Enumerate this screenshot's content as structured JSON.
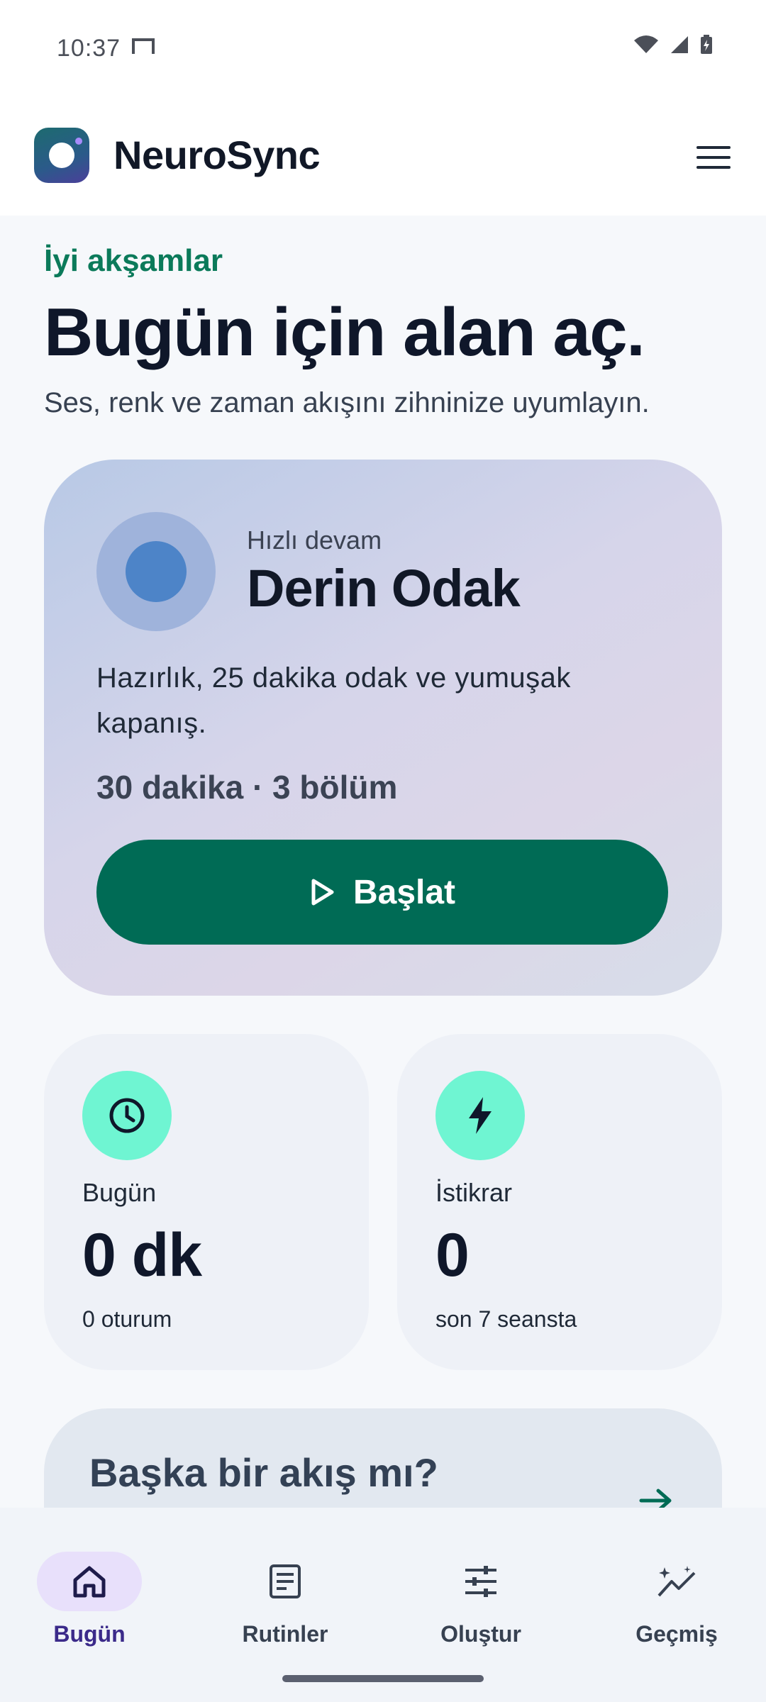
{
  "status_bar": {
    "time": "10:37"
  },
  "app_bar": {
    "brand": "NeuroSync"
  },
  "greeting": {
    "kicker": "İyi akşamlar",
    "headline": "Bugün için alan aç.",
    "subline": "Ses, renk ve zaman akışını zihninize uyumlayın."
  },
  "hero": {
    "kicker": "Hızlı devam",
    "title": "Derin Odak",
    "description": "Hazırlık, 25 dakika odak ve yumuşak kapanış.",
    "meta": "30 dakika · 3 bölüm",
    "start_label": "Başlat"
  },
  "stats": [
    {
      "icon": "clock-icon",
      "label": "Bugün",
      "value": "0 dk",
      "sub": "0 oturum"
    },
    {
      "icon": "bolt-icon",
      "label": "İstikrar",
      "value": "0",
      "sub": "son 7 seansta"
    }
  ],
  "discover": {
    "title": "Başka bir akış mı?"
  },
  "bottom_nav": {
    "items": [
      {
        "label": "Bugün",
        "icon": "home-icon",
        "active": true
      },
      {
        "label": "Rutinler",
        "icon": "document-icon",
        "active": false
      },
      {
        "label": "Oluştur",
        "icon": "sliders-icon",
        "active": false
      },
      {
        "label": "Geçmiş",
        "icon": "sparkle-chart-icon",
        "active": false
      }
    ]
  },
  "colors": {
    "accent": "#006b55",
    "greeting": "#0b7a5a",
    "stat_icon_bg": "#6ff5d2",
    "nav_active_bg": "#e8e0fb"
  }
}
